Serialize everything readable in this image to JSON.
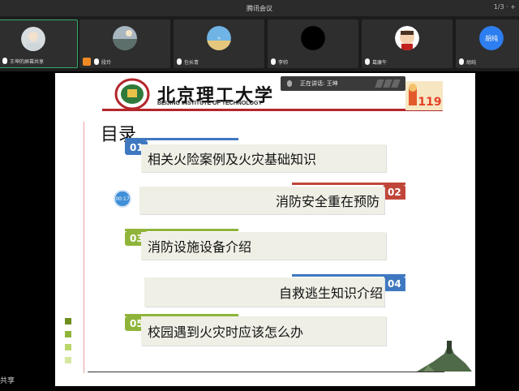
{
  "app": {
    "title": "腾讯会议",
    "window_controls": "1/3 · +",
    "bottom_left_text": "共享"
  },
  "participants": [
    {
      "name": "王坤的屏幕共享",
      "avatar": "photo-icon",
      "active": true
    },
    {
      "name": "段玲",
      "avatar": "landscape-icon",
      "active": false
    },
    {
      "name": "包长青",
      "avatar": "globe-icon",
      "active": false
    },
    {
      "name": "李帅",
      "avatar": "black-circle-icon",
      "active": false
    },
    {
      "name": "葛康午",
      "avatar": "cartoon-icon",
      "active": false
    },
    {
      "name": "胡纯",
      "avatar": "胡纯",
      "active": false
    }
  ],
  "speaking": {
    "label": "正在讲话: 王坤"
  },
  "slide": {
    "university_cn": "北京理工大学",
    "university_en": "BEIJING INSTITUTE OF TECHNOLOGY",
    "toc_title": "目录",
    "timer": "00:17",
    "items": [
      {
        "num": "01",
        "text": "相关火险案例及火灾基础知识",
        "color": "#3f78c0",
        "align": "left"
      },
      {
        "num": "02",
        "text": "消防安全重在预防",
        "color": "#c0463a",
        "align": "right"
      },
      {
        "num": "03",
        "text": "消防设施设备介绍",
        "color": "#8fb43a",
        "align": "left"
      },
      {
        "num": "04",
        "text": "自救逃生知识介绍",
        "color": "#3f78c0",
        "align": "right"
      },
      {
        "num": "05",
        "text": "校园遇到火灾时应该怎么办",
        "color": "#8fb43a",
        "align": "left"
      }
    ],
    "badge": "119"
  },
  "colors": {
    "blue": "#3f78c0",
    "red": "#c0463a",
    "green": "#8fb43a",
    "bit_red": "#b3262b"
  }
}
